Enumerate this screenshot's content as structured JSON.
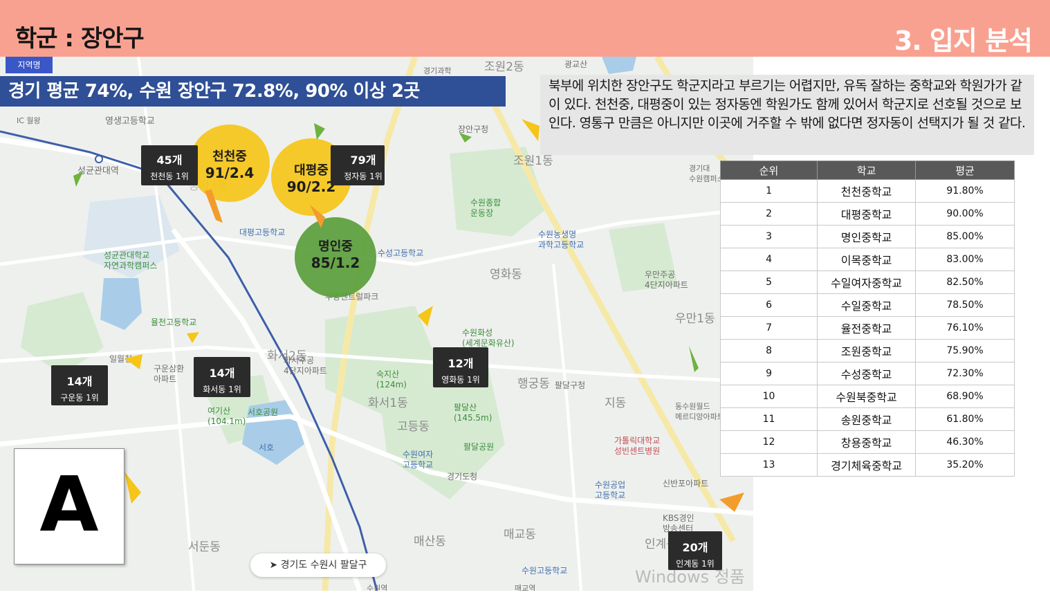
{
  "header": {
    "title": "학군 : 장안구",
    "section": "3. 입지 분석"
  },
  "map": {
    "region_tag": "지역명",
    "banner": "경기 평균 74%, 수원 장안구 72.8%, 90% 이상 2곳",
    "circles": [
      {
        "name": "천천중",
        "value": "91/2.4",
        "color": "#f5c518"
      },
      {
        "name": "대평중",
        "value": "90/2.2",
        "color": "#f5c518"
      },
      {
        "name": "명인중",
        "value": "85/1.2",
        "color": "#5a9e3c"
      }
    ],
    "boxes": [
      {
        "count": "45개",
        "rank": "천천동 1위"
      },
      {
        "count": "79개",
        "rank": "정자동 1위"
      },
      {
        "count": "14개",
        "rank": "구운동 1위"
      },
      {
        "count": "14개",
        "rank": "화서동 1위"
      },
      {
        "count": "12개",
        "rank": "영화동 1위"
      },
      {
        "count": "20개",
        "rank": "인계동 1위"
      }
    ],
    "labels": {
      "seonggyun_station": "성균관대역",
      "youngseng": "영생고등학교",
      "station_ic": "IC 월왕",
      "seonggyun_campus": "성균관대학교\n자연과학캠퍼스",
      "yulcheon": "율천고등학교",
      "ilwolcheon": "일월천",
      "guwun": "구운삼환\n아파트",
      "hwaseo2": "화서2동",
      "hwaseo_apt": "화서주공\n4단지아파트",
      "yeogisan": "여기산\n(104.1m)",
      "seoho_park": "서호공원",
      "seoho": "서호",
      "sukjisan": "숙지산\n(124m)",
      "hwaseo1": "화서1동",
      "godeung": "고등동",
      "suwon_yeoja": "수원여자\n고등학교",
      "paldalsan": "팔달산\n(145.5m)",
      "paldal_park": "팔달공원",
      "gyeonggi_do": "경기도청",
      "haenggung": "행궁동",
      "paldalgu": "팔달구청",
      "jidong": "지동",
      "hwaseong": "수원화성\n(세계문화유산)",
      "yeonghwa": "영화동",
      "suseong": "수성고등학교",
      "woobang": "우방센트럴파크",
      "daepyeong_hs": "대평고등학교",
      "jochon": "조원1동",
      "jangan_office": "장안구청",
      "sports": "수원종합\n운동장",
      "agri_hs": "수원농생명\n과학고등학교",
      "umanjugong": "우만주공\n4단지아파트",
      "uman1": "우만1동",
      "catholic": "가톨릭대학교\n성빈센트병원",
      "technical_hs": "수원공업\n고등학교",
      "sinban": "신반포아파트",
      "kbs": "KBS경인\n방송센터",
      "ingye": "인계동",
      "suwon_hs": "수원고등학교",
      "maegyo": "매교동",
      "maesan": "매산동",
      "seodun": "서둔동",
      "maegyo_station": "매교역",
      "station_sign": "수원역",
      "gyeonggi_science": "경기과학",
      "jowon2": "조원2동",
      "gwanggyosan": "광교산",
      "daewoo": "경기대\n수원캠퍼스",
      "dongsuwon": "동수원월드\n메르디앙아파트",
      "myeongin_jeongja": "정자3동",
      "hwaseojeong": "화서2동",
      "suwon_bukjung": "수원북중학교"
    },
    "location_bar": "경기도 수원시 팔달구",
    "a_label": "A",
    "watermark": "Windows 정품"
  },
  "description": "북부에 위치한 장안구도 학군지라고 부르기는 어렵지만, 유독 잘하는 중학교와 학원가가 같이 있다. 천천중, 대평중이 있는 정자동엔 학원가도 함께 있어서 학군지로 선호될 것으로 보인다. 영통구 만큼은 아니지만 이곳에 거주할 수 밖에 없다면 정자동이 선택지가 될 것 같다.",
  "table": {
    "headers": [
      "순위",
      "학교",
      "평균"
    ],
    "rows": [
      [
        "1",
        "천천중학교",
        "91.80%"
      ],
      [
        "2",
        "대평중학교",
        "90.00%"
      ],
      [
        "3",
        "명인중학교",
        "85.00%"
      ],
      [
        "4",
        "이목중학교",
        "83.00%"
      ],
      [
        "5",
        "수일여자중학교",
        "82.50%"
      ],
      [
        "6",
        "수일중학교",
        "78.50%"
      ],
      [
        "7",
        "율전중학교",
        "76.10%"
      ],
      [
        "8",
        "조원중학교",
        "75.90%"
      ],
      [
        "9",
        "수성중학교",
        "72.30%"
      ],
      [
        "10",
        "수원북중학교",
        "68.90%"
      ],
      [
        "11",
        "송원중학교",
        "61.80%"
      ],
      [
        "12",
        "창용중학교",
        "46.30%"
      ],
      [
        "13",
        "경기체육중학교",
        "35.20%"
      ]
    ]
  }
}
